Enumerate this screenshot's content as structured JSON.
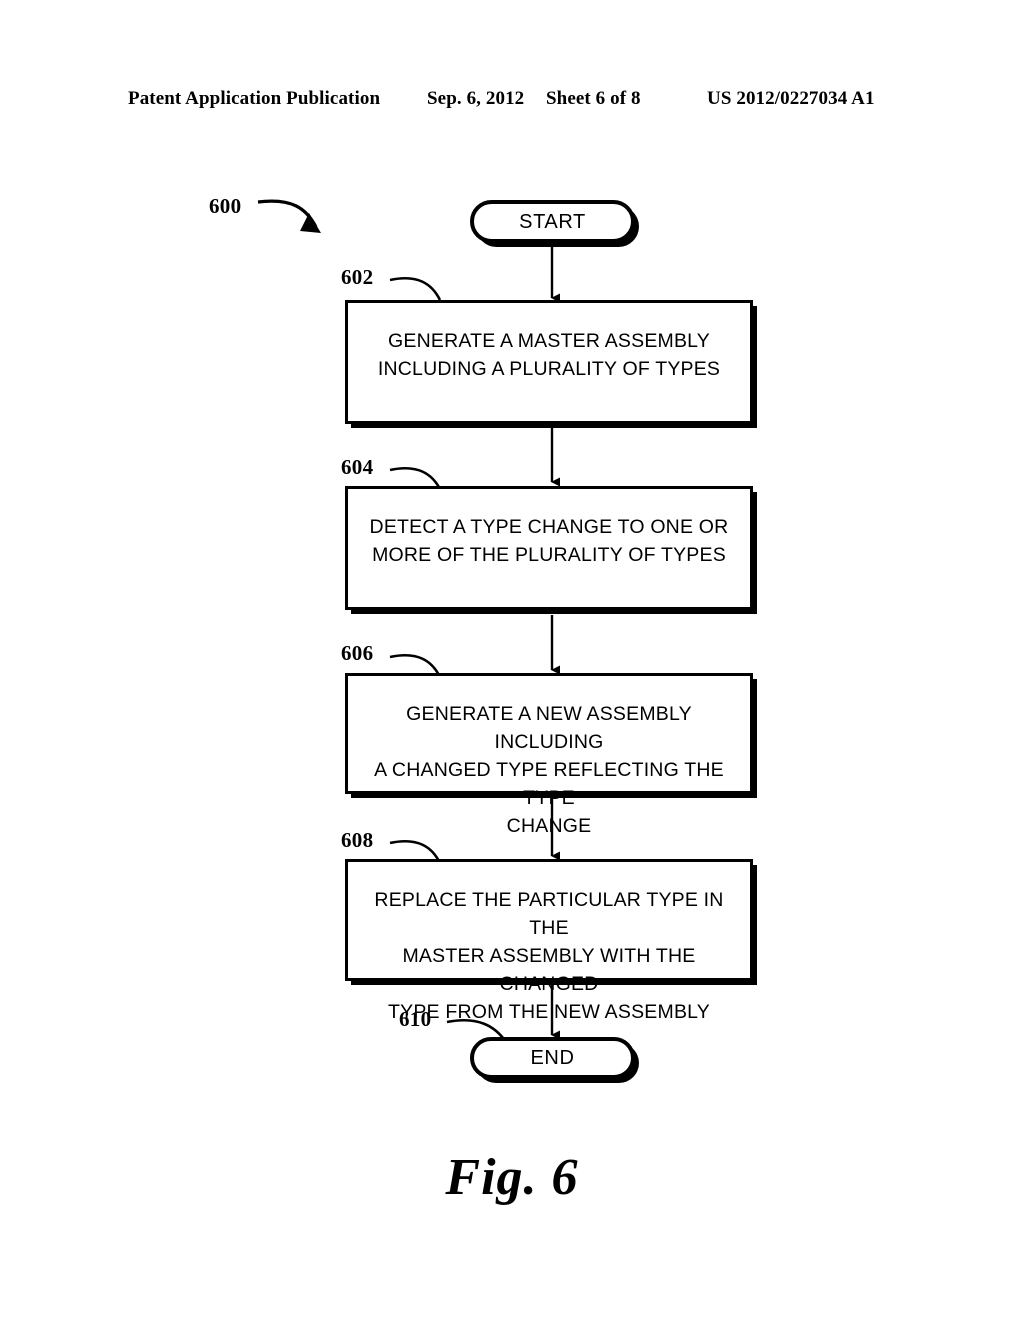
{
  "header": {
    "publication": "Patent Application Publication",
    "date": "Sep. 6, 2012",
    "sheet": "Sheet 6 of 8",
    "patent_number": "US 2012/0227034 A1"
  },
  "figure": {
    "caption": "Fig. 6",
    "flow_ref": "600",
    "nodes": [
      {
        "id": "start",
        "type": "terminator",
        "label": "START",
        "ref": null
      },
      {
        "id": "step-602",
        "type": "process",
        "ref": "602",
        "label": "GENERATE A MASTER ASSEMBLY\nINCLUDING A PLURALITY OF TYPES"
      },
      {
        "id": "step-604",
        "type": "process",
        "ref": "604",
        "label": "DETECT A TYPE CHANGE TO ONE OR\nMORE OF THE PLURALITY OF TYPES"
      },
      {
        "id": "step-606",
        "type": "process",
        "ref": "606",
        "label": "GENERATE A NEW ASSEMBLY INCLUDING\nA CHANGED TYPE REFLECTING THE TYPE\nCHANGE"
      },
      {
        "id": "step-608",
        "type": "process",
        "ref": "608",
        "label": "REPLACE THE PARTICULAR TYPE IN THE\nMASTER ASSEMBLY WITH THE CHANGED\nTYPE FROM THE NEW ASSEMBLY"
      },
      {
        "id": "end",
        "type": "terminator",
        "label": "END",
        "ref": "610"
      }
    ],
    "colors": {
      "stroke": "#000000",
      "fill": "#ffffff"
    }
  }
}
